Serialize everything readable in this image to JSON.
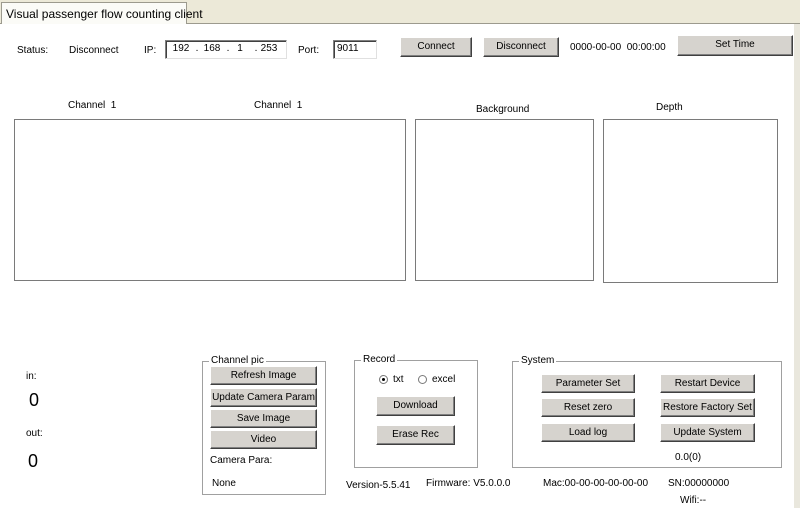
{
  "window": {
    "tab_title": "Visual passenger flow counting client"
  },
  "connection": {
    "status_label": "Status:",
    "status_value": "Disconnect",
    "ip_label": "IP:",
    "ip": [
      "192",
      "168",
      "1",
      "253"
    ],
    "ip_sep": ".",
    "port_label": "Port:",
    "port_value": "9011",
    "connect_label": "Connect",
    "disconnect_label": "Disconnect",
    "datetime": "0000-00-00  00:00:00",
    "set_time_label": "Set Time"
  },
  "views": {
    "channel_left_label": "Channel  1",
    "channel_mid_label": "Channel  1",
    "background_label": "Background",
    "depth_label": "Depth"
  },
  "counts": {
    "in_label": "in:",
    "in_value": "0",
    "out_label": "out:",
    "out_value": "0"
  },
  "channel_pic": {
    "title": "Channel pic",
    "refresh_label": "Refresh Image",
    "update_label": "Update Camera Param",
    "save_label": "Save Image",
    "video_label": "Video",
    "camera_para_label": "Camera Para:",
    "camera_para_value": "None"
  },
  "record": {
    "title": "Record",
    "format_txt": "txt",
    "format_excel": "excel",
    "selected_format": "txt",
    "download_label": "Download",
    "erase_label": "Erase Rec"
  },
  "system": {
    "title": "System",
    "parameter_set_label": "Parameter Set",
    "restart_label": "Restart Device",
    "reset_zero_label": "Reset zero",
    "restore_factory_label": "Restore Factory Set",
    "load_log_label": "Load log",
    "update_system_label": "Update System",
    "update_progress": "0.0(0)"
  },
  "footer": {
    "version": "Version-5.5.41",
    "firmware": "Firmware: V5.0.0.0",
    "mac": "Mac:00-00-00-00-00-00",
    "sn": "SN:00000000",
    "wifi": "Wifi:--"
  }
}
